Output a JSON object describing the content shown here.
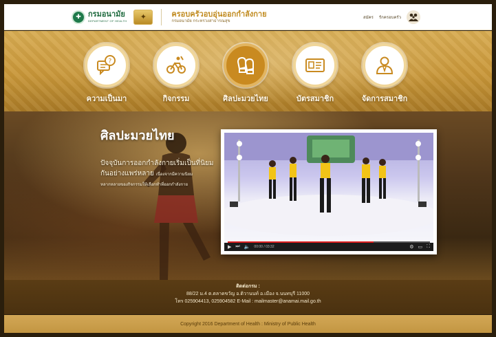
{
  "header": {
    "logo_mark": "✚",
    "logo_name": "กรมอนามัย",
    "logo_sub": "DEPARTMENT OF HEALTH",
    "campaign_icon": "campaign-logo-icon",
    "site_title": "ครอบครัวอบอุ่นออกกำลังกาย",
    "site_subtitle": "กรมอนามัย กระทรวงสาธารณสุข",
    "links": [
      "สมัคร",
      "รักครอบครัว"
    ],
    "avatar_icon": "family-avatar-icon"
  },
  "nav": {
    "items": [
      {
        "label": "ความเป็นมา",
        "icon": "chat-question-icon",
        "active": false
      },
      {
        "label": "กิจกรรม",
        "icon": "bicycle-activity-icon",
        "active": false
      },
      {
        "label": "ศิลปะมวยไทย",
        "icon": "boxing-gloves-icon",
        "active": true
      },
      {
        "label": "บัตรสมาชิก",
        "icon": "member-card-icon",
        "active": false
      },
      {
        "label": "จัดการสมาชิก",
        "icon": "member-manage-icon",
        "active": false
      }
    ]
  },
  "hero": {
    "title": "ศิลปะมวยไทย",
    "desc_line1": "ปัจจุบันการออกกำลังกายเริ่มเป็นที่นิยม",
    "desc_line2": "กันอย่างแพร่หลาย",
    "desc_line2_small": "เนื่องจากมีความนิยม",
    "desc_line3": "หลากหลายของกิจกรรมให้เลือกทำที่ออกกำลังกาย"
  },
  "video": {
    "time": "00:00 / 03:32",
    "progress": 0.72,
    "controls": [
      "play-icon",
      "skip-icon",
      "volume-icon",
      "settings-icon",
      "subtitles-icon",
      "fullscreen-icon"
    ]
  },
  "contact": {
    "title": "ติดต่อกรม :",
    "address": "88/22 ม.4 ต.ตลาดขวัญ อ.ติวานนท์ อ.เมือง จ.นนทบุรี 11000",
    "phone_email": "โทร 025904413, 025904582   E-Mail : mailmaster@anamai.mail.go.th"
  },
  "footer": {
    "copyright": "Copyright 2016 Department of Health : Ministry of Public Health"
  },
  "colors": {
    "accent": "#c98a20",
    "header_bg": "#ffffff",
    "nav_band": "#c89638",
    "footer_bg": "#c39642",
    "logo_green": "#1e7a4a"
  }
}
